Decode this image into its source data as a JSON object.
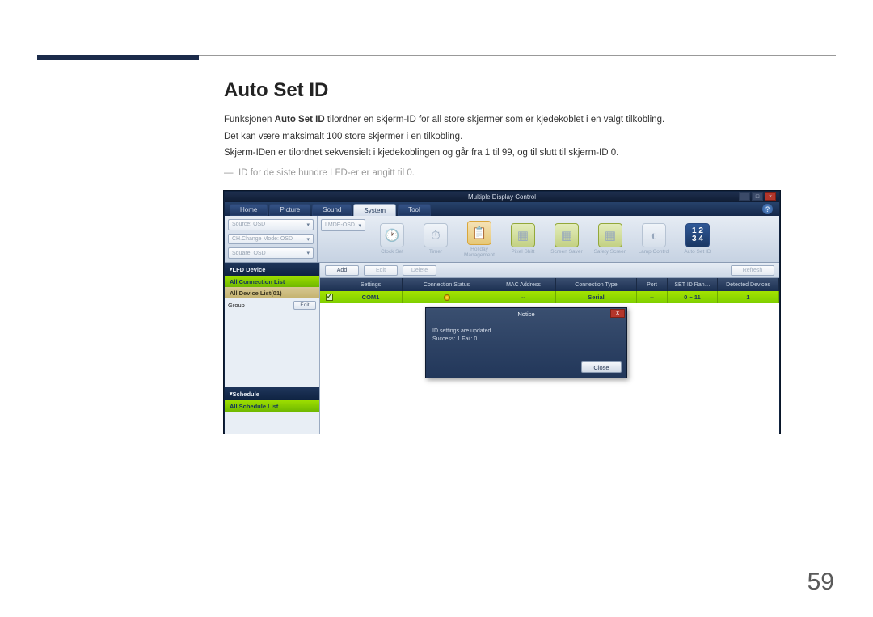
{
  "doc": {
    "heading": "Auto Set ID",
    "p1a": "Funksjonen ",
    "p1b": "Auto Set ID",
    "p1c": " tilordner en skjerm-ID for all store skjermer som er kjedekoblet i en valgt tilkobling.",
    "p2": "Det kan være maksimalt 100 store skjermer i en tilkobling.",
    "p3": "Skjerm-IDen er tilordnet sekvensielt i kjedekoblingen og går fra 1 til 99, og til slutt til skjerm-ID 0.",
    "foot": "ID for de siste hundre LFD-er er angitt til 0.",
    "page_number": "59"
  },
  "app": {
    "title": "Multiple Display Control",
    "win": {
      "min": "–",
      "max": "□",
      "close": "×"
    },
    "tabs": {
      "home": "Home",
      "picture": "Picture",
      "sound": "Sound",
      "system": "System",
      "tool": "Tool"
    },
    "help": "?",
    "combo1": "Source: OSD",
    "combo2": "CH.Change Mode: OSD",
    "combo3": "Square: OSD",
    "combo_mid": "LMDE-OSD",
    "ribbon": {
      "clock": "Clock Set",
      "timer": "Timer",
      "holiday": "Holiday Management",
      "pixel": "Pixel Shift",
      "screen": "Screen Saver",
      "safety": "Safety Screen",
      "lamp": "Lamp Control",
      "auto": "Auto Set ID",
      "auto_glyph": "1 2\n3 4"
    },
    "toolbar": {
      "add": "Add",
      "edit": "Edit",
      "delete": "Delete",
      "refresh": "Refresh"
    },
    "sidebar": {
      "lfd": "LFD Device",
      "all_conn": "All Connection List",
      "all_dev": "All Device List(01)",
      "group": "Group",
      "edit": "Edit",
      "schedule": "Schedule",
      "all_sched": "All Schedule List"
    },
    "cols": {
      "settings": "Settings",
      "status": "Connection Status",
      "mac": "MAC Address",
      "ctype": "Connection Type",
      "port": "Port",
      "range": "SET ID Ran…",
      "detected": "Detected Devices"
    },
    "row": {
      "settings": "COM1",
      "mac": "--",
      "ctype": "Serial",
      "port": "--",
      "range": "0 ~ 11",
      "detected": "1"
    },
    "modal": {
      "title": "Notice",
      "line1": "ID settings are updated.",
      "line2": "Success: 1  Fail: 0",
      "close": "Close",
      "x": "X"
    }
  }
}
